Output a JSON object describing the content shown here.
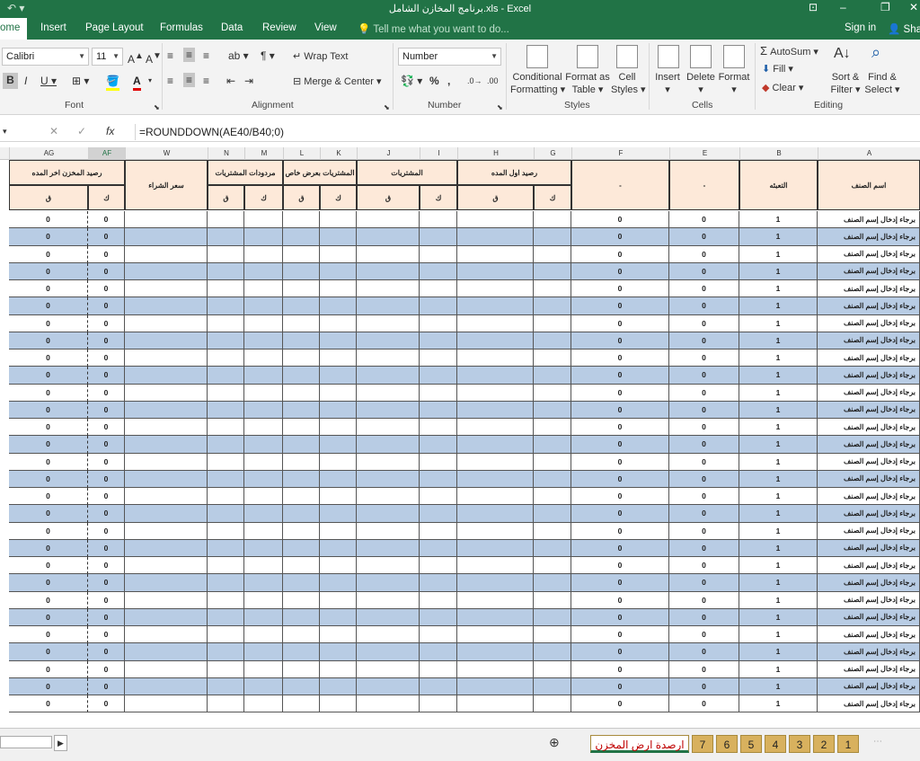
{
  "window": {
    "title": "برنامج المخازن الشامل.xls - Excel"
  },
  "tabs": [
    "ome",
    "Insert",
    "Page Layout",
    "Formulas",
    "Data",
    "Review",
    "View"
  ],
  "tell_me": "Tell me what you want to do...",
  "sign_in": "Sign in",
  "share": "Shar",
  "ribbon": {
    "font_name": "Calibri",
    "font_size": "11",
    "font_group": "Font",
    "wrap_text": "Wrap Text",
    "merge_center": "Merge & Center",
    "alignment_group": "Alignment",
    "number_format": "Number",
    "number_group": "Number",
    "conditional": "Conditional",
    "formatting": "Formatting ▾",
    "format_as": "Format as",
    "table": "Table ▾",
    "cell": "Cell",
    "styles": "Styles ▾",
    "styles_group": "Styles",
    "insert": "Insert",
    "delete": "Delete",
    "format": "Format",
    "cells_group": "Cells",
    "autosum": "AutoSum ▾",
    "fill": "Fill ▾",
    "clear": "Clear ▾",
    "sort": "Sort &",
    "filter": "Filter ▾",
    "find": "Find &",
    "select": "Select ▾",
    "editing_group": "Editing"
  },
  "formula_bar": {
    "name_box": "",
    "formula": "=ROUNDDOWN(AE40/B40;0)"
  },
  "columns": [
    "AG",
    "AF",
    "W",
    "N",
    "M",
    "L",
    "K",
    "J",
    "I",
    "H",
    "G",
    "F",
    "E",
    "B",
    "A"
  ],
  "headers": {
    "end_balance": "رصيد المخزن اخر المده",
    "price": "سعر الشراء",
    "purchase_returns": "مردودات المشتريات",
    "special_purchase": "المشتريات بعرض خاص",
    "purchases": "المشتريات",
    "start_balance": "رصيد اول المده",
    "f": "-",
    "e": "-",
    "packing": "التعبئه",
    "item_name": "اسم الصنف",
    "q": "ق",
    "k": "ك"
  },
  "row_values": {
    "zero": "0",
    "one": "1",
    "item_placeholder": "برجاء إدخال إسم الصنف"
  },
  "sheet_tabs": [
    "ارصدة ارض المخزن",
    "7",
    "6",
    "5",
    "4",
    "3",
    "2",
    "1"
  ],
  "colors": {
    "accent": "#217346",
    "row_band": "#b8cce4",
    "header_fill": "#fde9d9"
  }
}
